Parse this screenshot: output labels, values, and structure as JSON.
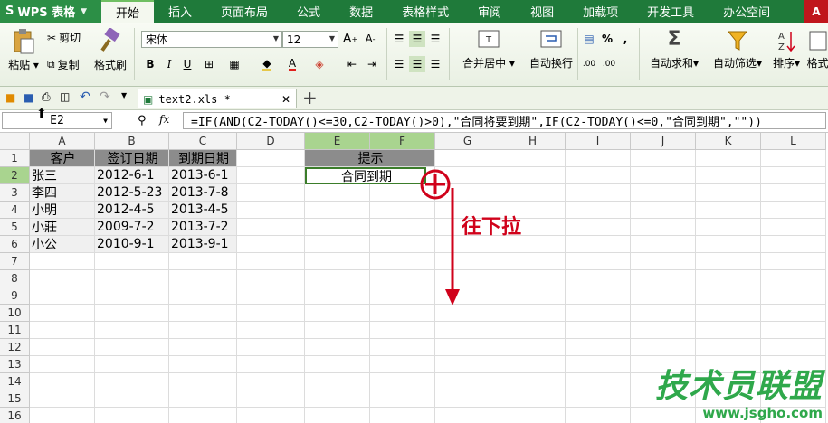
{
  "app": {
    "brand": "WPS 表格",
    "logo": "S"
  },
  "menu_tabs": [
    "开始",
    "插入",
    "页面布局",
    "公式",
    "数据",
    "表格样式",
    "审阅",
    "视图",
    "加载项",
    "开发工具",
    "办公空间"
  ],
  "ribbon": {
    "paste": "粘贴",
    "cut": "剪切",
    "copy": "复制",
    "format_painter": "格式刷",
    "font_name": "宋体",
    "font_size": "12",
    "merge_center": "合并居中",
    "wrap_text": "自动换行",
    "percent": "%",
    "comma": ",",
    "autosum": "自动求和",
    "autofilter": "自动筛选",
    "sort": "排序",
    "format_partial": "格式",
    "bold": "B",
    "italic": "I",
    "underline": "U",
    "font_color_letter": "A",
    "grow_font": "A",
    "shrink_font": "A",
    "dec_inc_top": ".00",
    "dec_inc_bottom": ".00"
  },
  "file_tab": {
    "name": "text2.xls *",
    "close": "✕",
    "add": "+"
  },
  "namebox": "E2",
  "fx_label": "fx",
  "formula": "=IF(AND(C2-TODAY()<=30,C2-TODAY()>0),\"合同将要到期\",IF(C2-TODAY()<=0,\"合同到期\",\"\"))",
  "columns": [
    "A",
    "B",
    "C",
    "D",
    "E",
    "F",
    "G",
    "H",
    "I",
    "J",
    "K",
    "L"
  ],
  "rows": [
    "1",
    "2",
    "3",
    "4",
    "5",
    "6",
    "7",
    "8",
    "9",
    "10",
    "11",
    "12",
    "13",
    "14",
    "15",
    "16"
  ],
  "table": {
    "headers": [
      "客户",
      "签订日期",
      "到期日期"
    ],
    "rows": [
      [
        "张三",
        "2012-6-1",
        "2013-6-1"
      ],
      [
        "李四",
        "2012-5-23",
        "2013-7-8"
      ],
      [
        "小明",
        "2012-4-5",
        "2013-4-5"
      ],
      [
        "小莊",
        "2009-7-2",
        "2013-7-2"
      ],
      [
        "小公",
        "2010-9-1",
        "2013-9-1"
      ]
    ]
  },
  "tip": {
    "header": "提示",
    "value": "合同到期"
  },
  "annotation": "往下拉",
  "watermark": {
    "logo": "技术员联盟",
    "url": "www.jsgho.com"
  },
  "colors": {
    "menubar": "#1f7a3a",
    "accent": "#2c8f46",
    "annotation": "#d0021b",
    "selection": "#a9d48f"
  }
}
